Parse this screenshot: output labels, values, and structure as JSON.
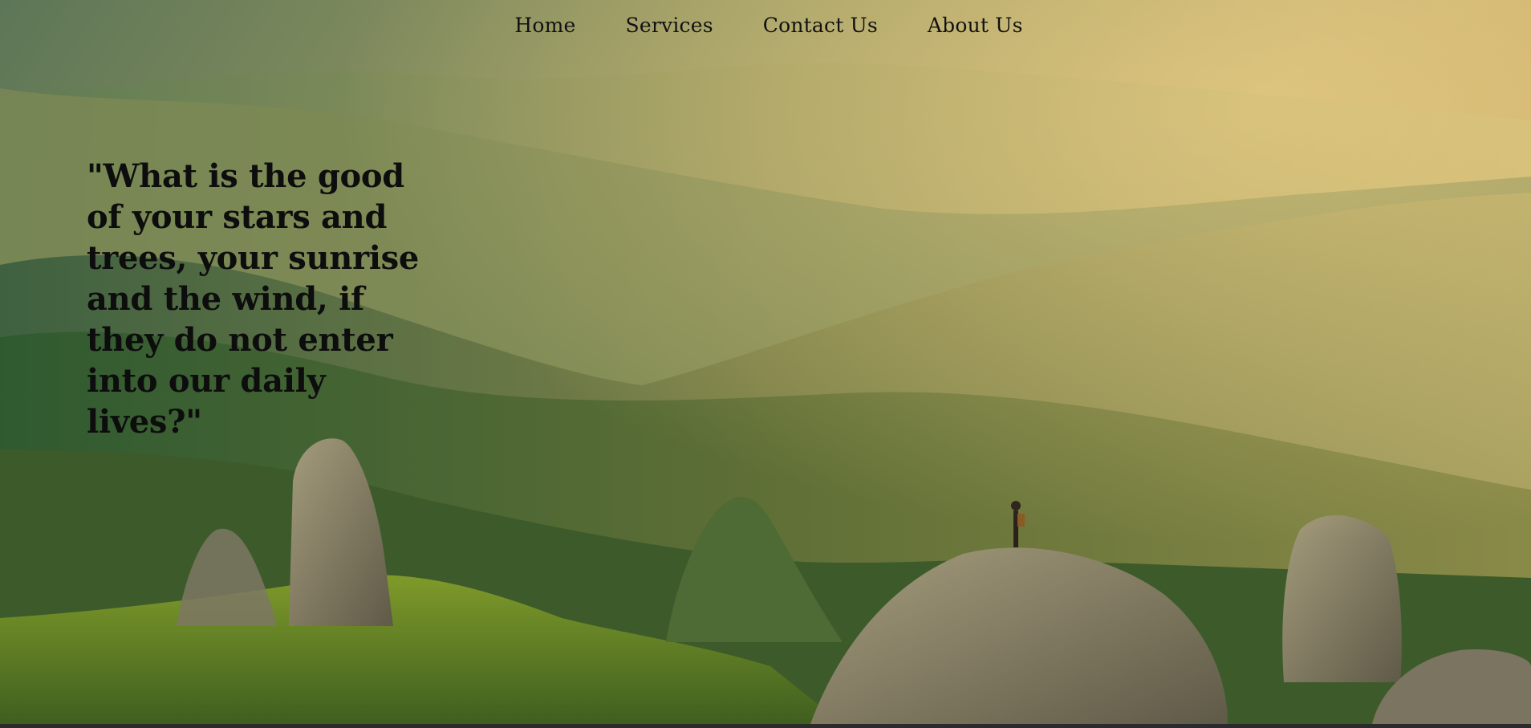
{
  "nav": {
    "items": [
      {
        "label": "Home"
      },
      {
        "label": "Services"
      },
      {
        "label": "Contact Us"
      },
      {
        "label": "About Us"
      }
    ]
  },
  "hero": {
    "quote": "\"What is the good of your stars and trees, your sunrise and the wind, if they do not enter into our daily lives?\""
  }
}
